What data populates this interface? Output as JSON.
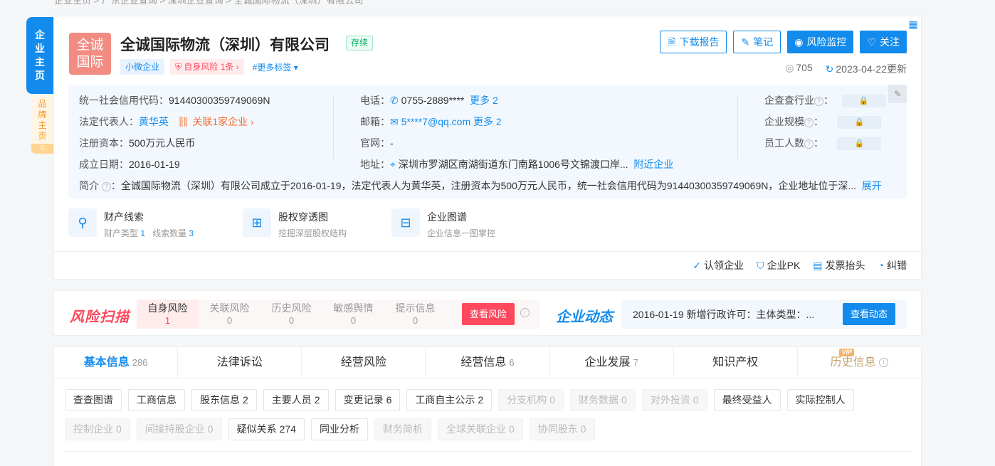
{
  "breadcrumb": "企业主页 > 广东企业查询 > 深圳企业查询 > 全诚国际物流（深圳）有限公司",
  "side": {
    "main_label": [
      "企",
      "业",
      "主",
      "页"
    ],
    "brand_label": [
      "品",
      "牌",
      "主",
      "页"
    ],
    "brand_count": "0"
  },
  "company": {
    "logo_text_1": "全诚",
    "logo_text_2": "国际",
    "name": "全诚国际物流（深圳）有限公司",
    "status": "存续",
    "tags": {
      "size": "小微企业",
      "risk": "自身风险 1条",
      "more": "#更多标签"
    }
  },
  "actions": {
    "download": "下载报告",
    "notes": "笔记",
    "monitor": "风险监控",
    "follow": "关注"
  },
  "meta": {
    "views": "705",
    "updated": "2023-04-22更新"
  },
  "info": {
    "credit_code_label": "统一社会信用代码：",
    "credit_code": "91440300359749069N",
    "legal_rep_label": "法定代表人：",
    "legal_rep": "黄华英",
    "related": "关联1家企业",
    "capital_label": "注册资本：",
    "capital": "500万元人民币",
    "founded_label": "成立日期：",
    "founded": "2016-01-19",
    "phone_label": "电话：",
    "phone": "0755-2889****",
    "phone_more": "更多 2",
    "email_label": "邮箱：",
    "email": "5****7@qq.com",
    "email_more": "更多 2",
    "website_label": "官网：",
    "website": "-",
    "address_label": "地址：",
    "address": "深圳市罗湖区南湖街道东门南路1006号文锦渡口岸...",
    "nearby": "附近企业",
    "industry_label": "企查查行业",
    "scale_label": "企业规模",
    "staff_label": "员工人数",
    "intro_label": "简介",
    "intro": "全诚国际物流（深圳）有限公司成立于2016-01-19，法定代表人为黄华英，注册资本为500万元人民币，统一社会信用代码为91440300359749069N，企业地址位于深...",
    "expand": "展开"
  },
  "features": [
    {
      "title": "财产线索",
      "sub1": "财产类型",
      "n1": "1",
      "sub2": "线索数量",
      "n2": "3"
    },
    {
      "title": "股权穿透图",
      "sub": "挖掘深层股权结构"
    },
    {
      "title": "企业图谱",
      "sub": "企业信息一图掌控"
    }
  ],
  "bottom_actions": {
    "claim": "认领企业",
    "pk": "企业PK",
    "invoice": "发票抬头",
    "correct": "纠错"
  },
  "risk_scan": {
    "title": "风险扫描",
    "items": [
      {
        "label": "自身风险",
        "count": "1"
      },
      {
        "label": "关联风险",
        "count": "0"
      },
      {
        "label": "历史风险",
        "count": "0"
      },
      {
        "label": "敏感舆情",
        "count": "0"
      },
      {
        "label": "提示信息",
        "count": "0"
      }
    ],
    "button": "查看风险"
  },
  "dynamics": {
    "title": "企业动态",
    "text": "2016-01-19 新增行政许可：主体类型：...",
    "button": "查看动态"
  },
  "tabs": [
    {
      "label": "基本信息",
      "count": "286"
    },
    {
      "label": "法律诉讼",
      "count": ""
    },
    {
      "label": "经营风险",
      "count": ""
    },
    {
      "label": "经营信息",
      "count": "6"
    },
    {
      "label": "企业发展",
      "count": "7"
    },
    {
      "label": "知识产权",
      "count": ""
    },
    {
      "label": "历史信息",
      "count": ""
    }
  ],
  "vip_badge": "VIP",
  "chips": [
    {
      "label": "查查图谱",
      "count": ""
    },
    {
      "label": "工商信息",
      "count": ""
    },
    {
      "label": "股东信息",
      "count": "2"
    },
    {
      "label": "主要人员",
      "count": "2"
    },
    {
      "label": "变更记录",
      "count": "6"
    },
    {
      "label": "工商自主公示",
      "count": "2"
    },
    {
      "label": "分支机构",
      "count": "0"
    },
    {
      "label": "财务数据",
      "count": "0"
    },
    {
      "label": "对外投资",
      "count": "0"
    },
    {
      "label": "最终受益人",
      "count": ""
    },
    {
      "label": "实际控制人",
      "count": ""
    },
    {
      "label": "控制企业",
      "count": "0"
    },
    {
      "label": "间接持股企业",
      "count": "0"
    },
    {
      "label": "疑似关系",
      "count": "274"
    },
    {
      "label": "同业分析",
      "count": ""
    },
    {
      "label": "财务简析",
      "count": ""
    },
    {
      "label": "全球关联企业",
      "count": "0"
    },
    {
      "label": "协同股东",
      "count": "0"
    }
  ]
}
